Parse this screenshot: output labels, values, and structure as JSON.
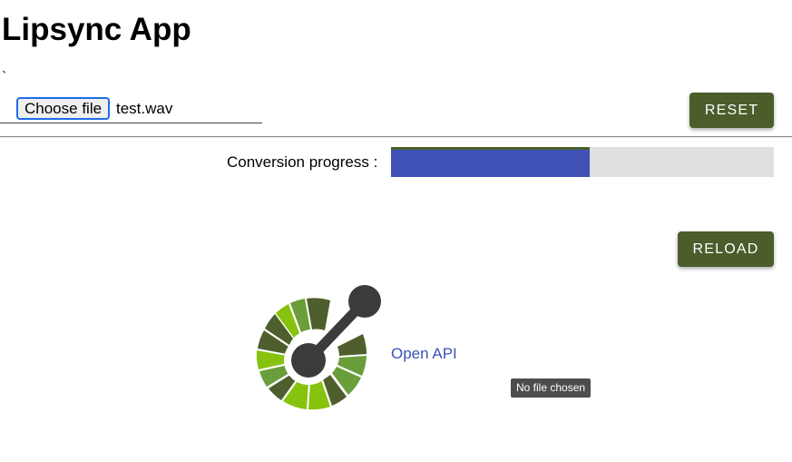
{
  "header": {
    "title": "Lipsync App",
    "stray_mark": "`"
  },
  "file_input": {
    "button_label": "Choose file",
    "file_name": "test.wav"
  },
  "buttons": {
    "reset_label": "RESET",
    "reload_label": "RELOAD"
  },
  "progress": {
    "label": "Conversion progress :",
    "fraction": 0.52
  },
  "openapi": {
    "logo_icon": "openapi-logo-icon",
    "link_text": "Open API"
  },
  "tooltip": {
    "text": "No file chosen"
  },
  "colors": {
    "primary_button": "#4a5d2b",
    "progress_fill": "#3f51b5",
    "progress_track": "#e0e0e0",
    "link": "#3f51b5"
  }
}
